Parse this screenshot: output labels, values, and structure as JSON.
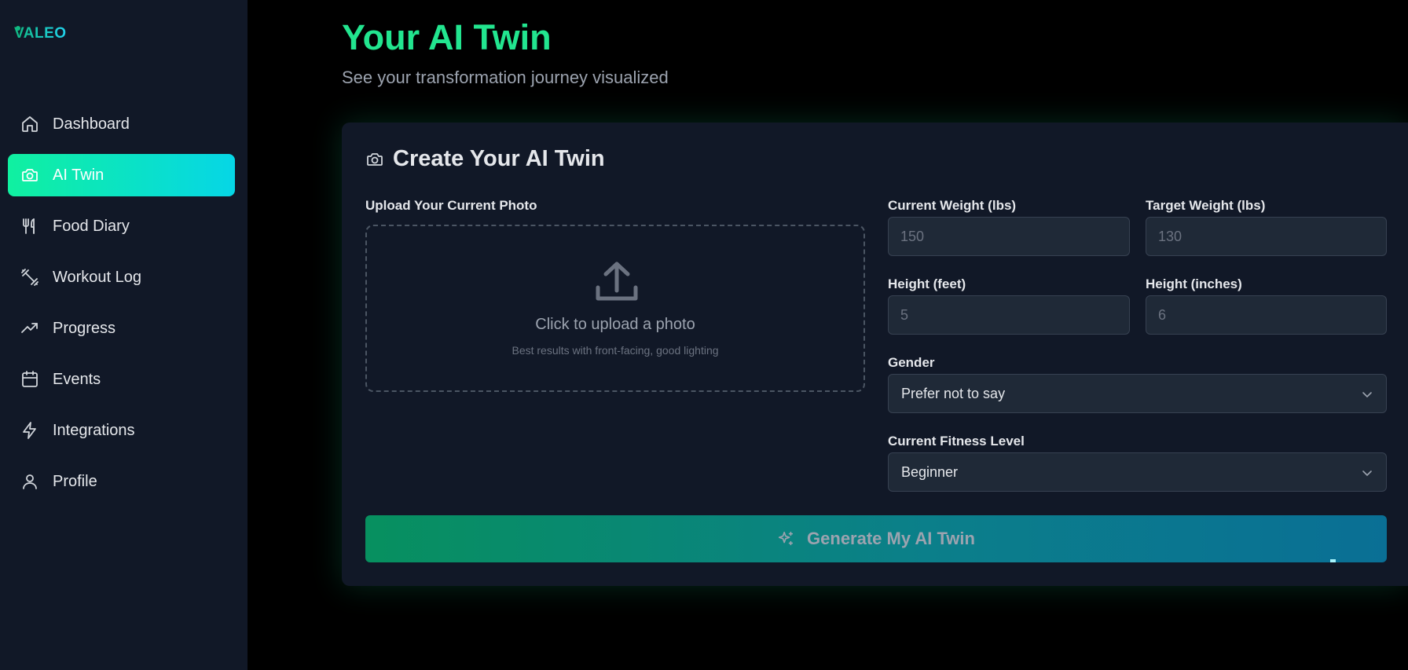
{
  "brand": {
    "name": "VALEO"
  },
  "sidebar": {
    "items": [
      {
        "label": "Dashboard",
        "icon": "home-icon",
        "active": false
      },
      {
        "label": "AI Twin",
        "icon": "camera-icon",
        "active": true
      },
      {
        "label": "Food Diary",
        "icon": "utensils-icon",
        "active": false
      },
      {
        "label": "Workout Log",
        "icon": "dumbbell-icon",
        "active": false
      },
      {
        "label": "Progress",
        "icon": "trending-up-icon",
        "active": false
      },
      {
        "label": "Events",
        "icon": "calendar-icon",
        "active": false
      },
      {
        "label": "Integrations",
        "icon": "zap-icon",
        "active": false
      },
      {
        "label": "Profile",
        "icon": "user-icon",
        "active": false
      }
    ]
  },
  "header": {
    "title": "Your AI Twin",
    "subtitle": "See your transformation journey visualized"
  },
  "card": {
    "title": "Create Your AI Twin",
    "upload": {
      "label": "Upload Your Current Photo",
      "prompt": "Click to upload a photo",
      "hint": "Best results with front-facing, good lighting"
    },
    "fields": {
      "current_weight": {
        "label": "Current Weight (lbs)",
        "placeholder": "150"
      },
      "target_weight": {
        "label": "Target Weight (lbs)",
        "placeholder": "130"
      },
      "height_feet": {
        "label": "Height (feet)",
        "placeholder": "5"
      },
      "height_inches": {
        "label": "Height (inches)",
        "placeholder": "6"
      }
    },
    "gender": {
      "label": "Gender",
      "selected": "Prefer not to say"
    },
    "fitness_level": {
      "label": "Current Fitness Level",
      "selected": "Beginner"
    },
    "generate_label": "Generate My AI Twin"
  },
  "colors": {
    "accent_green": "#22e58f",
    "active_gradient_start": "#10f0a0",
    "active_gradient_end": "#06d6e6",
    "sidebar_bg": "#111827",
    "page_bg": "#000000"
  }
}
